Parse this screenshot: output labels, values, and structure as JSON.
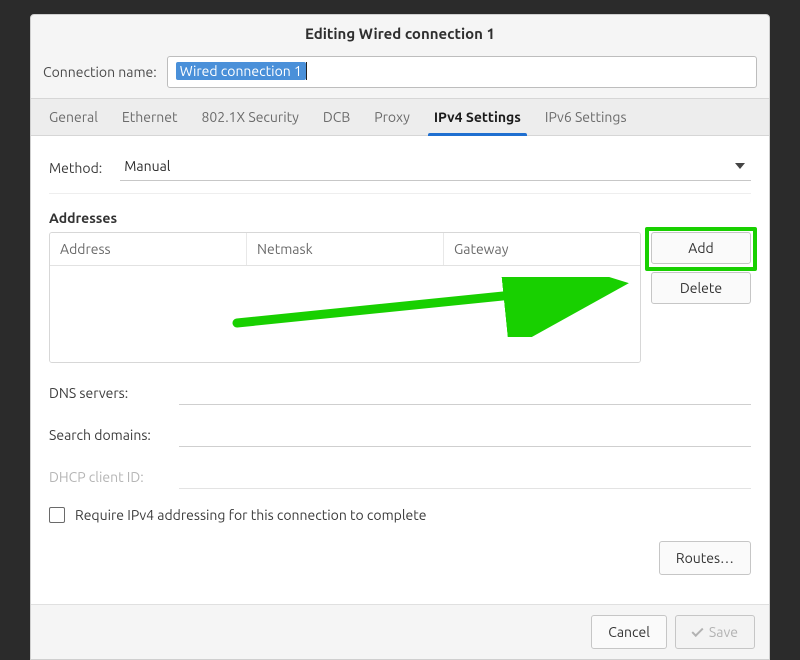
{
  "window": {
    "title": "Editing Wired connection 1",
    "connection_name_label": "Connection name:",
    "connection_name_value": "Wired connection 1"
  },
  "tabs": [
    {
      "label": "General",
      "active": false
    },
    {
      "label": "Ethernet",
      "active": false
    },
    {
      "label": "802.1X Security",
      "active": false
    },
    {
      "label": "DCB",
      "active": false
    },
    {
      "label": "Proxy",
      "active": false
    },
    {
      "label": "IPv4 Settings",
      "active": true
    },
    {
      "label": "IPv6 Settings",
      "active": false
    }
  ],
  "ipv4": {
    "method_label": "Method:",
    "method_value": "Manual",
    "addresses_heading": "Addresses",
    "columns": {
      "address": "Address",
      "netmask": "Netmask",
      "gateway": "Gateway"
    },
    "buttons": {
      "add": "Add",
      "delete": "Delete"
    },
    "dns_label": "DNS servers:",
    "search_label": "Search domains:",
    "dhcp_label": "DHCP client ID:",
    "require_label": "Require IPv4 addressing for this connection to complete",
    "routes_label": "Routes…"
  },
  "footer": {
    "cancel": "Cancel",
    "save": "Save"
  },
  "annotation": {
    "highlight": "add-button",
    "arrow_color": "#18d000"
  }
}
